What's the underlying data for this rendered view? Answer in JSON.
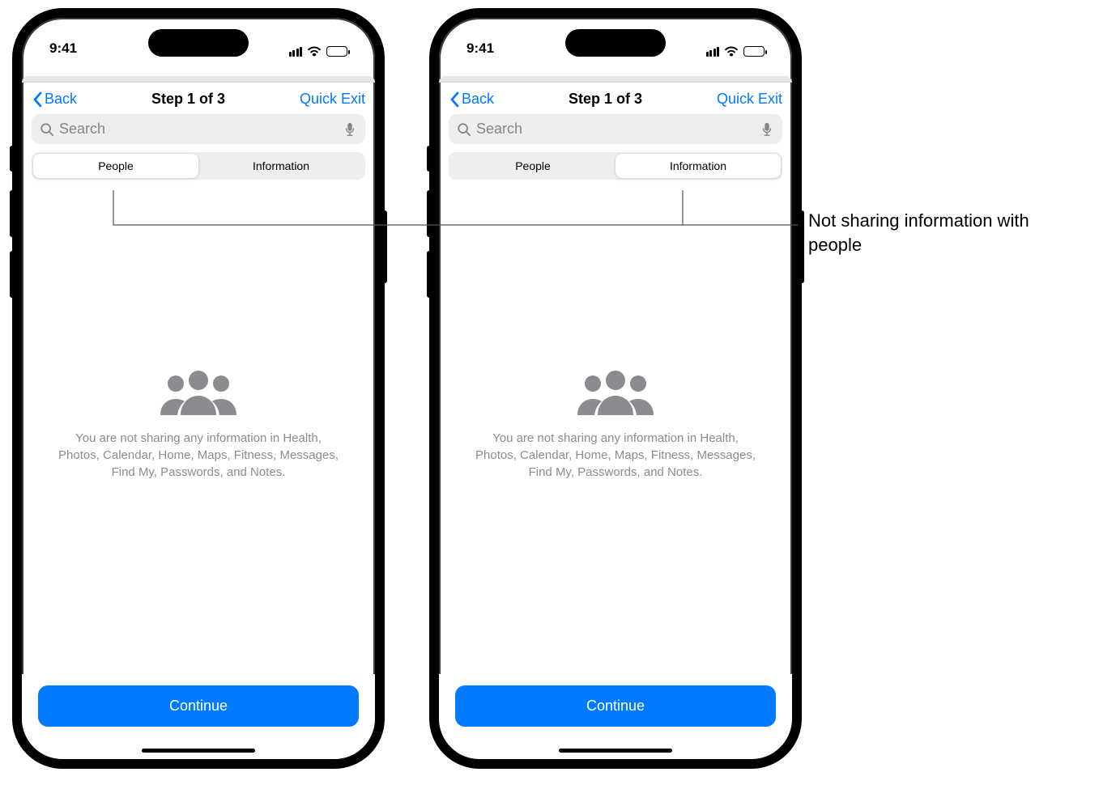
{
  "status": {
    "time": "9:41"
  },
  "nav": {
    "back_label": "Back",
    "title": "Step 1 of 3",
    "quick_exit": "Quick Exit"
  },
  "search": {
    "placeholder": "Search"
  },
  "segment": {
    "people": "People",
    "information": "Information"
  },
  "empty_text": "You are not sharing any information in Health, Photos, Calendar, Home, Maps, Fitness, Messages, Find My, Passwords, and Notes.",
  "continue_label": "Continue",
  "callout": "Not sharing information with people"
}
